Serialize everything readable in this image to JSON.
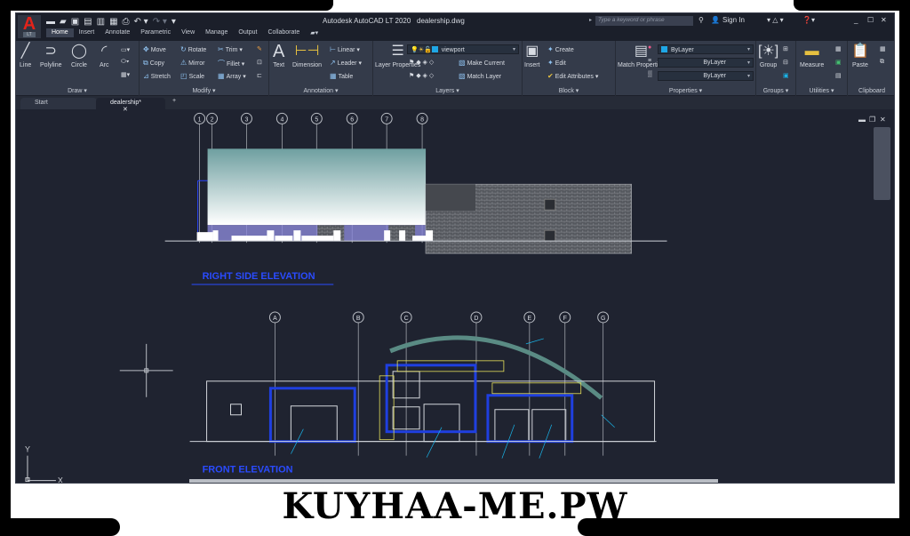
{
  "window": {
    "app_title": "Autodesk AutoCAD LT 2020",
    "file_title": "dealership.dwg",
    "app_logo": "A",
    "app_logo_sub": "LT",
    "search_placeholder": "Type a keyword or phrase",
    "sign_in": "Sign In"
  },
  "quick_access": [
    "new-icon",
    "open-icon",
    "save-icon",
    "save-as-icon",
    "plot-preview-icon",
    "publish-icon",
    "print-icon",
    "undo-icon",
    "redo-icon",
    "customize-icon"
  ],
  "ribbon_tabs": [
    {
      "label": "Home",
      "active": true
    },
    {
      "label": "Insert"
    },
    {
      "label": "Annotate"
    },
    {
      "label": "Parametric"
    },
    {
      "label": "View"
    },
    {
      "label": "Manage"
    },
    {
      "label": "Output"
    },
    {
      "label": "Collaborate"
    }
  ],
  "panels": {
    "draw": {
      "label": "Draw",
      "tools": [
        "Line",
        "Polyline",
        "Circle",
        "Arc"
      ]
    },
    "modify": {
      "label": "Modify",
      "tools": [
        "Move",
        "Rotate",
        "Trim",
        "Copy",
        "Mirror",
        "Fillet",
        "Stretch",
        "Scale",
        "Array"
      ]
    },
    "annotation": {
      "label": "Annotation",
      "tools": [
        "Text",
        "Dimension",
        "Linear",
        "Leader",
        "Table"
      ]
    },
    "layers": {
      "label": "Layers",
      "layer_properties": "Layer Properties",
      "current_layer": "viewport",
      "make_current": "Make Current",
      "match_layer": "Match Layer"
    },
    "block": {
      "label": "Block",
      "insert": "Insert",
      "create": "Create",
      "edit": "Edit",
      "edit_attributes": "Edit Attributes"
    },
    "properties": {
      "label": "Properties",
      "match_properties": "Match Properties",
      "color": "ByLayer",
      "linetype": "ByLayer",
      "lineweight": "ByLayer"
    },
    "groups": {
      "label": "Groups",
      "group": "Group"
    },
    "utilities": {
      "label": "Utilities",
      "measure": "Measure"
    },
    "clipboard": {
      "label": "Clipboard",
      "paste": "Paste"
    }
  },
  "file_tabs": [
    {
      "label": "Start"
    },
    {
      "label": "dealership*",
      "active": true
    }
  ],
  "drawing": {
    "right_elevation_title": "RIGHT SIDE ELEVATION",
    "front_elevation_title": "FRONT ELEVATION",
    "grid_numbers": [
      "1",
      "2",
      "3",
      "4",
      "5",
      "6",
      "7",
      "8"
    ],
    "grid_letters": [
      "A",
      "B",
      "C",
      "D",
      "E",
      "F",
      "G"
    ],
    "ucs_x": "X",
    "ucs_y": "Y"
  },
  "colors": {
    "accent_blue": "#1f3fe0",
    "title_blue": "#2a4bff",
    "annotation_cyan": "#19b4e8",
    "dimension_yellow": "#e6e05a",
    "canvas_bg": "#1f2330"
  },
  "watermark": "KUYHAA-ME.PW"
}
